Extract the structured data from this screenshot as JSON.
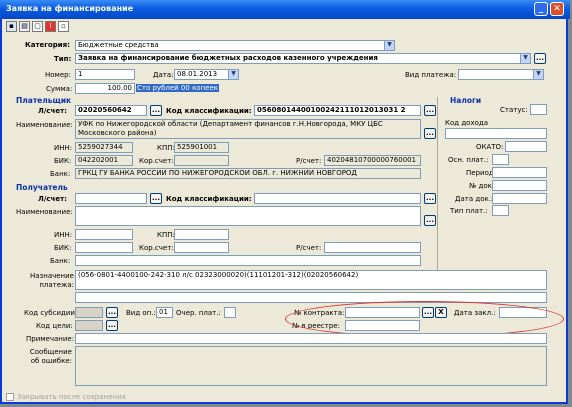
{
  "window": {
    "title": "Заявка на финансирование"
  },
  "toolbar": {
    "icons": [
      "save-icon",
      "print-icon",
      "copy-icon",
      "alert-icon",
      "delete-icon"
    ]
  },
  "header": {
    "category_label": "Категория:",
    "category_value": "Бюджетные средства",
    "type_label": "Тип:",
    "type_value": "Заявка на финансирование бюджетных расходов казенного учреждения",
    "number_label": "Номер:",
    "number_value": "1",
    "date_label": "Дата:",
    "date_value": "08.01.2013",
    "paytype_label": "Вид платежа:",
    "paytype_value": "",
    "sum_label": "Сумма:",
    "sum_value": "100.00",
    "sum_words": "Сто рублей 00 копеек"
  },
  "payer": {
    "section": "Плательщик",
    "account_label": "Л/счет:",
    "account_value": "02020560642",
    "class_label": "Код классификации:",
    "class_value": "05608014400100242111012013031 2",
    "name_label": "Наименование:",
    "name_value": "УФК по Нижегородской области (Департамент финансов г.Н.Новгорода, МКУ ЦБС Московского района)",
    "inn_label": "ИНН:",
    "inn_value": "5259027344",
    "kpp_label": "КПП:",
    "kpp_value": "525901001",
    "bik_label": "БИК:",
    "bik_value": "042202001",
    "corr_label": "Кор.счет:",
    "corr_value": "",
    "rs_label": "Р/счет:",
    "rs_value": "40204810700000760001",
    "bank_label": "Банк:",
    "bank_value": "ГРКЦ ГУ БАНКА РОССИИ ПО НИЖЕГОРОДСКОЙ ОБЛ. г. НИЖНИЙ НОВГОРОД"
  },
  "taxes": {
    "section": "Налоги",
    "status_label": "Статус:",
    "income_label": "Код дохода",
    "okato_label": "ОКАТО:",
    "basis_label": "Осн. плат.:",
    "period_label": "Период:",
    "docnum_label": "№ док.:",
    "docdate_label": "Дата док.:",
    "paytype_label": "Тип плат.:"
  },
  "recipient": {
    "section": "Получатель",
    "account_label": "Л/счет:",
    "class_label": "Код классификации:",
    "name_label": "Наименование:",
    "inn_label": "ИНН:",
    "kpp_label": "КПП:",
    "bik_label": "БИК:",
    "corr_label": "Кор.счет:",
    "rs_label": "Р/счет:",
    "bank_label": "Банк:"
  },
  "purpose": {
    "label": "Назначение платежа:",
    "value": "(056-0801-4400100-242-310 л/с 02323000020)(11101201-312)(02020560642)"
  },
  "bottom": {
    "subsidy_label": "Код субсидии:",
    "opvid_label": "Вид оп.:",
    "opvid_value": "01",
    "queue_label": "Очер. плат.:",
    "contract_label": "№ контракта:",
    "contract_date_label": "Дата закл.:",
    "goal_label": "Код цели:",
    "registry_label": "№ в реестре:",
    "note_label": "Примечание:",
    "error_label": "Сообщение об ошибке:",
    "close_after_save": "Закрывать после сохранения"
  },
  "icons": {
    "button_ellipsis": "...",
    "button_clear": "X",
    "arrow": "▼",
    "win_min": "_",
    "win_close": "✕"
  },
  "colors": {
    "accent": "#0a5ce0",
    "highlight": "#316ac5",
    "annotation": "#d8342f"
  }
}
